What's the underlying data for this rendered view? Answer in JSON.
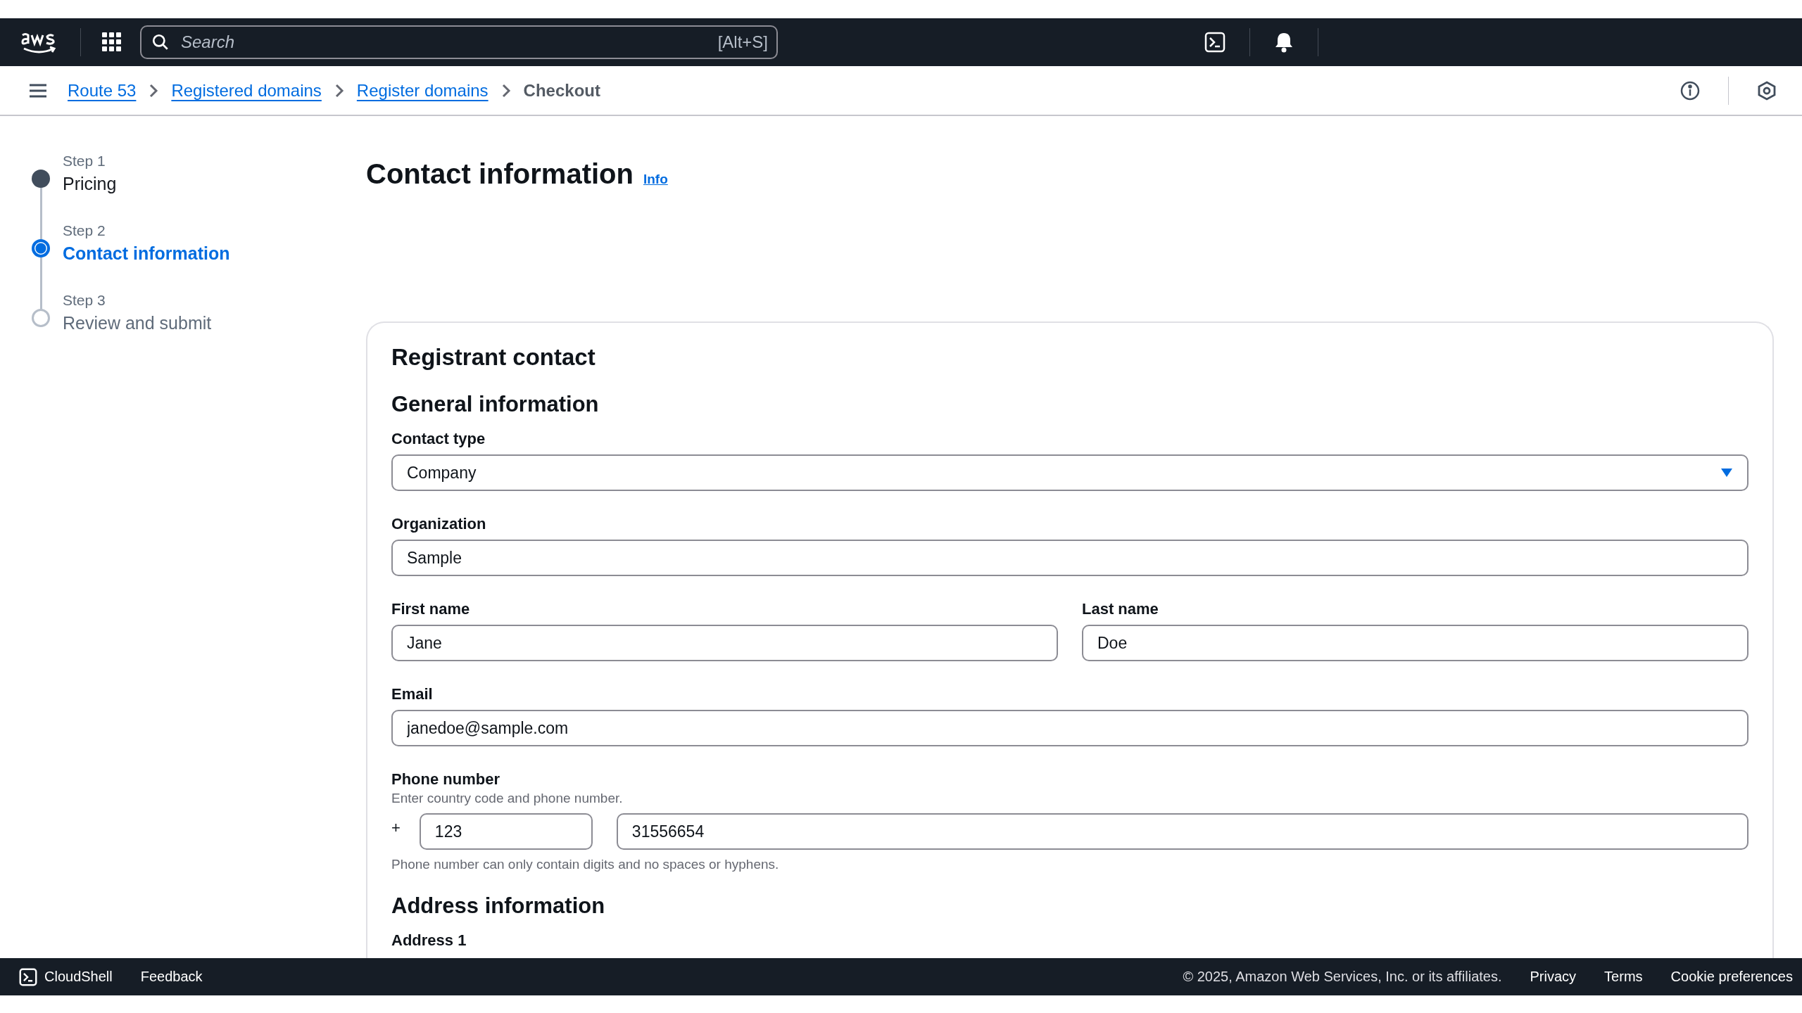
{
  "header": {
    "search": {
      "placeholder": "Search",
      "shortcut": "[Alt+S]"
    }
  },
  "breadcrumbs": [
    {
      "label": "Route 53",
      "kind": "link"
    },
    {
      "label": "Registered domains",
      "kind": "link"
    },
    {
      "label": "Register domains",
      "kind": "link"
    },
    {
      "label": "Checkout",
      "kind": "current"
    }
  ],
  "steps": [
    {
      "step": "Step 1",
      "title": "Pricing",
      "completed": true,
      "selected": false
    },
    {
      "step": "Step 2",
      "title": "Contact information",
      "completed": false,
      "selected": true
    },
    {
      "step": "Step 3",
      "title": "Review and submit",
      "completed": false,
      "selected": false
    }
  ],
  "page": {
    "title": "Contact information",
    "info": "Info"
  },
  "card": {
    "title": "Registrant contact",
    "general": {
      "heading": "General information",
      "contact_type": {
        "label": "Contact type",
        "value": "Company"
      },
      "organization": {
        "label": "Organization",
        "value": "Sample"
      },
      "first_name": {
        "label": "First name",
        "value": "Jane"
      },
      "last_name": {
        "label": "Last name",
        "value": "Doe"
      },
      "email": {
        "label": "Email",
        "value": "janedoe@sample.com"
      },
      "phone": {
        "label": "Phone number",
        "description": "Enter country code and phone number.",
        "prefix": "+",
        "country_code": "123",
        "number": "31556654",
        "constraint": "Phone number can only contain digits and no spaces or hyphens."
      }
    },
    "address": {
      "heading": "Address information",
      "address1_label": "Address 1"
    }
  },
  "footer": {
    "cloudshell": "CloudShell",
    "feedback": "Feedback",
    "copyright": "© 2025, Amazon Web Services, Inc. or its affiliates.",
    "links": [
      "Privacy",
      "Terms",
      "Cookie preferences"
    ]
  }
}
